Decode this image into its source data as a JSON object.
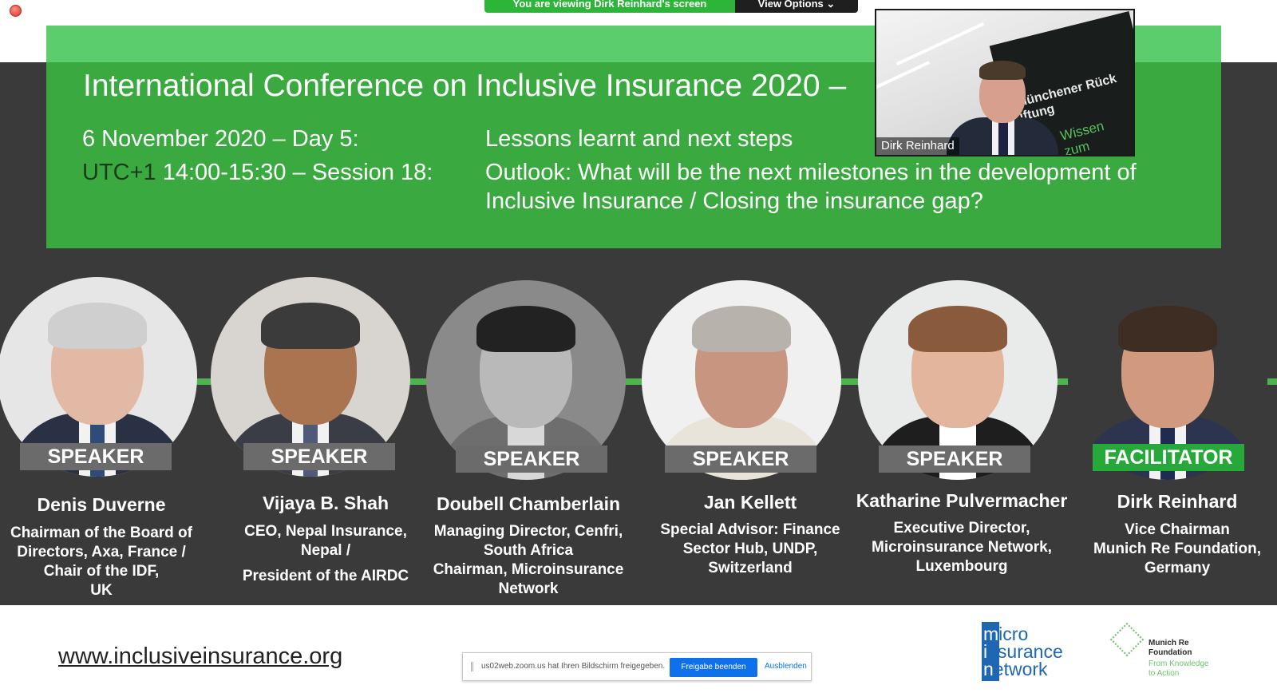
{
  "window": {
    "close_icon": "red-circle-icon"
  },
  "zoom_bar": {
    "share_text": "You are viewing Dirk Reinhard's screen",
    "view_options_label": "View Options",
    "chevron_icon": "chevron-down-icon"
  },
  "video": {
    "participant_name": "Dirk Reinhard",
    "board_line1": "Münchener Rück",
    "board_line2": "iftung",
    "board_line3": "Wissen zum"
  },
  "banner": {
    "title": "International Conference on Inclusive Insurance 2020 –",
    "date_label": "6 November 2020 – Day 5:",
    "date_topic": "Lessons learnt and next steps",
    "utc_label": "UTC+1",
    "session_label": " 14:00-15:30 – Session 18:",
    "session_line1": "Outlook: What will be the next milestones in the development of",
    "session_line2": "Inclusive Insurance / Closing the insurance gap?"
  },
  "speakers": [
    {
      "badge": "SPEAKER",
      "name": "Denis Duverne",
      "role_lines": [
        "Chairman of the Board of",
        "Directors, Axa, France /",
        "Chair of the IDF,",
        "UK"
      ]
    },
    {
      "badge": "SPEAKER",
      "name": "Vijaya B. Shah",
      "role_lines": [
        "CEO, Nepal Insurance,",
        "Nepal /",
        "President of the AIRDC"
      ]
    },
    {
      "badge": "SPEAKER",
      "name": "Doubell Chamberlain",
      "role_lines": [
        "Managing Director, Cenfri,",
        "South Africa",
        "Chairman, Microinsurance",
        "Network"
      ]
    },
    {
      "badge": "SPEAKER",
      "name": "Jan Kellett",
      "role_lines": [
        "Special Advisor: Finance",
        "Sector Hub, UNDP,",
        "Switzerland"
      ]
    },
    {
      "badge": "SPEAKER",
      "name": "Katharine Pulvermacher",
      "role_lines": [
        "Executive Director,",
        "Microinsurance Network,",
        "Luxembourg"
      ]
    },
    {
      "badge": "FACILITATOR",
      "name": "Dirk Reinhard",
      "role_lines": [
        "Vice Chairman",
        "Munich Re Foundation,",
        "Germany"
      ]
    }
  ],
  "footer": {
    "website": "www.inclusiveinsurance.org",
    "notice_text": "us02web.zoom.us hat Ihren Bildschirm freigegeben.",
    "notice_stop": "Freigabe beenden",
    "notice_hide": "Ausblenden",
    "mn_logo": {
      "l1_first": "m",
      "l1_rest": "icro",
      "l2_first": "i",
      "l2_rest": "nsurance",
      "l3_first": "n",
      "l3_rest": "etwork"
    },
    "mrf_logo": {
      "name_l1": "Munich Re",
      "name_l2": "Foundation",
      "tag_l1": "From Knowledge",
      "tag_l2": "to Action"
    }
  },
  "colors": {
    "banner_green": "#3aaa40",
    "banner_light": "#5ccd6c",
    "dark_bg": "#3a3a3a",
    "speaker_badge": "#6b6b6b",
    "facilitator_badge": "#27a83a",
    "zoom_green": "#2db53a",
    "zoom_blue": "#0e71eb"
  }
}
